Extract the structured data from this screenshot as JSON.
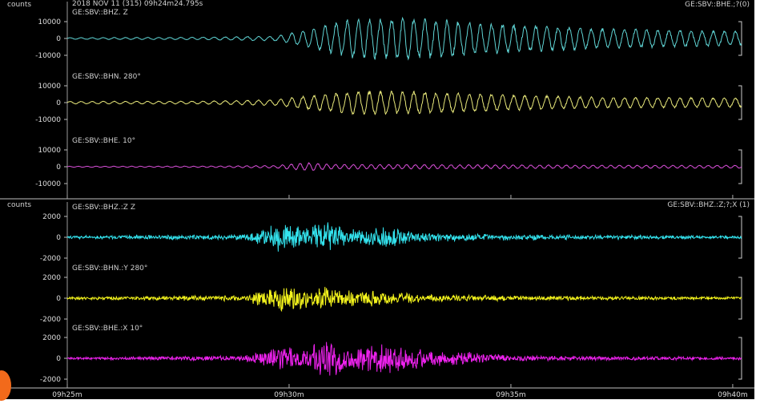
{
  "chart_data": [
    {
      "type": "line",
      "panel": "top",
      "header": {
        "units": "counts",
        "timestamp": "2018 NOV 11 (315)  09h24m24.795s",
        "right_label": "GE:SBV::BHE.;?(0)"
      },
      "xlim": [
        25.0,
        40.2
      ],
      "xticks": [
        {
          "v": 25,
          "label": "09h25m"
        },
        {
          "v": 30,
          "label": "09h30m"
        },
        {
          "v": 35,
          "label": "09h35m"
        },
        {
          "v": 40,
          "label": "09h40m"
        }
      ],
      "traces": [
        {
          "name": "GE:SBV::BHZ. Z",
          "color": "#5fd4d4",
          "ylim": [
            -10000,
            10000
          ],
          "yticks": [
            10000,
            0,
            -10000
          ],
          "envelope": [
            [
              25.0,
              500
            ],
            [
              28.0,
              800
            ],
            [
              29.7,
              1500
            ],
            [
              30.3,
              5000
            ],
            [
              31.5,
              13000
            ],
            [
              33.0,
              13000
            ],
            [
              35.0,
              9000
            ],
            [
              37.0,
              6500
            ],
            [
              40.2,
              4500
            ]
          ],
          "period": 0.25
        },
        {
          "name": "GE:SBV::BHN. 280°",
          "color": "#e8e87a",
          "ylim": [
            -10000,
            10000
          ],
          "yticks": [
            10000,
            0,
            -10000
          ],
          "envelope": [
            [
              25.0,
              800
            ],
            [
              28.0,
              900
            ],
            [
              29.7,
              1800
            ],
            [
              30.3,
              4000
            ],
            [
              31.5,
              7500
            ],
            [
              33.0,
              7000
            ],
            [
              35.0,
              5000
            ],
            [
              37.0,
              3500
            ],
            [
              40.2,
              3000
            ]
          ],
          "period": 0.25
        },
        {
          "name": "GE:SBV::BHE. 10°",
          "color": "#d94fd9",
          "ylim": [
            -10000,
            10000
          ],
          "yticks": [
            10000,
            0,
            -10000
          ],
          "envelope": [
            [
              25.0,
              300
            ],
            [
              28.0,
              400
            ],
            [
              29.7,
              800
            ],
            [
              30.4,
              2600
            ],
            [
              31.0,
              1500
            ],
            [
              33.0,
              1400
            ],
            [
              35.0,
              1200
            ],
            [
              37.0,
              1000
            ],
            [
              40.2,
              900
            ]
          ],
          "period": 0.2
        }
      ]
    },
    {
      "type": "line",
      "panel": "bottom",
      "header": {
        "units": "counts",
        "right_label": "GE:SBV::BHZ.:Z;?;X (1)"
      },
      "xlim": [
        25.0,
        40.2
      ],
      "xticks": [
        {
          "v": 25,
          "label": "09h25m"
        },
        {
          "v": 30,
          "label": "09h30m"
        },
        {
          "v": 35,
          "label": "09h35m"
        },
        {
          "v": 40,
          "label": "09h40m"
        }
      ],
      "traces": [
        {
          "name": "GE:SBV::BHZ.:Z Z",
          "color": "#33e3ee",
          "ylim": [
            -2000,
            2000
          ],
          "yticks": [
            2000,
            0,
            -2000
          ],
          "envelope": [
            [
              25.0,
              150
            ],
            [
              29.0,
              300
            ],
            [
              29.9,
              1800
            ],
            [
              30.3,
              900
            ],
            [
              30.8,
              1700
            ],
            [
              31.3,
              900
            ],
            [
              32.2,
              1100
            ],
            [
              33.0,
              500
            ],
            [
              35.0,
              300
            ],
            [
              40.2,
              150
            ]
          ]
        },
        {
          "name": "GE:SBV::BHN.:Y 280°",
          "color": "#f3f31c",
          "ylim": [
            -2000,
            2000
          ],
          "yticks": [
            2000,
            0,
            -2000
          ],
          "envelope": [
            [
              25.0,
              150
            ],
            [
              29.0,
              300
            ],
            [
              29.9,
              1600
            ],
            [
              30.3,
              1000
            ],
            [
              30.8,
              1200
            ],
            [
              31.3,
              800
            ],
            [
              32.2,
              800
            ],
            [
              33.0,
              400
            ],
            [
              35.0,
              250
            ],
            [
              40.2,
              150
            ]
          ]
        },
        {
          "name": "GE:SBV::BHE.:X 10°",
          "color": "#ee22ee",
          "ylim": [
            -2000,
            2000
          ],
          "yticks": [
            2000,
            0,
            -2000
          ],
          "envelope": [
            [
              25.0,
              100
            ],
            [
              29.0,
              300
            ],
            [
              29.8,
              1300
            ],
            [
              30.3,
              1000
            ],
            [
              30.8,
              2300
            ],
            [
              31.4,
              1200
            ],
            [
              32.2,
              1600
            ],
            [
              33.0,
              1000
            ],
            [
              35.0,
              300
            ],
            [
              40.2,
              150
            ]
          ]
        }
      ]
    }
  ]
}
